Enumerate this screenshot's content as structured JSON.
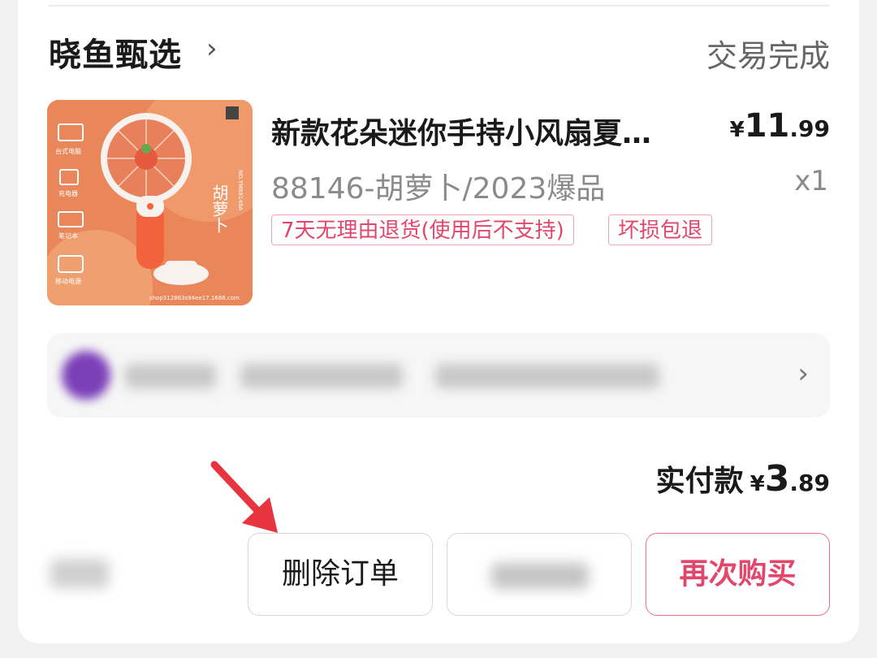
{
  "shop": {
    "name": "晓鱼甄选",
    "chevron_icon": "chevron-right-icon",
    "status": "交易完成"
  },
  "product": {
    "title": "新款花朵迷你手持小风扇夏…",
    "price": {
      "currency": "¥",
      "integer": "11",
      "decimal": ".99"
    },
    "sku": "88146-胡萝卜/2023爆品",
    "quantity": "x1",
    "tags": [
      "7天无理由退货(使用后不支持)",
      "坏损包退"
    ],
    "image": {
      "side_labels": [
        "台式电脑",
        "充电器",
        "笔记本",
        "移动电源"
      ],
      "vertical_text": "胡萝卜",
      "model": "NO.YM88146A",
      "url": "shop312863s94ee17.1688.com"
    }
  },
  "payment": {
    "label": "实付款",
    "currency": "¥",
    "integer": "3",
    "decimal": ".89"
  },
  "actions": {
    "delete": "删除订单",
    "rebuy": "再次购买"
  },
  "colors": {
    "accent": "#e0476a",
    "product_bg": "#e9875a",
    "arrow": "#e8343f"
  }
}
